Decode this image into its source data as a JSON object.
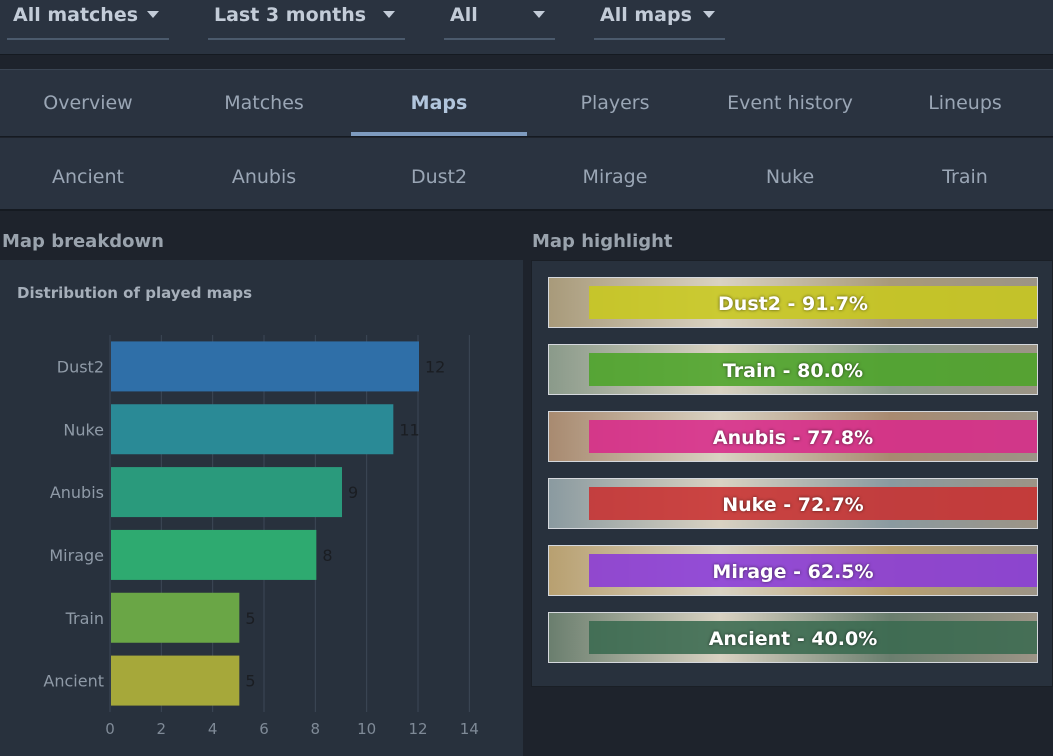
{
  "filters": [
    {
      "label": "All matches"
    },
    {
      "label": "Last 3 months"
    },
    {
      "label": "All"
    },
    {
      "label": "All maps"
    }
  ],
  "tabs": [
    "Overview",
    "Matches",
    "Maps",
    "Players",
    "Event history",
    "Lineups"
  ],
  "active_tab": "Maps",
  "map_tabs": [
    "Ancient",
    "Anubis",
    "Dust2",
    "Mirage",
    "Nuke",
    "Train"
  ],
  "map_breakdown": {
    "title": "Map breakdown",
    "chart_title": "Distribution of played maps"
  },
  "map_highlight": {
    "title": "Map highlight",
    "items": [
      {
        "label": "Dust2 - 91.7%",
        "color": "#c8c81e",
        "bg": "#a89a7a"
      },
      {
        "label": "Train - 80.0%",
        "color": "#4ca428",
        "bg": "#8a9a8a"
      },
      {
        "label": "Anubis - 77.8%",
        "color": "#d82a8a",
        "bg": "#a88a70"
      },
      {
        "label": "Nuke - 72.7%",
        "color": "#c83030",
        "bg": "#8a9aa0"
      },
      {
        "label": "Mirage - 62.5%",
        "color": "#8a3ad8",
        "bg": "#b8a070"
      },
      {
        "label": "Ancient - 40.0%",
        "color": "#3a6a50",
        "bg": "#6a7e6e"
      }
    ]
  },
  "chart_data": {
    "type": "bar",
    "orientation": "horizontal",
    "title": "Distribution of played maps",
    "categories": [
      "Dust2",
      "Nuke",
      "Anubis",
      "Mirage",
      "Train",
      "Ancient"
    ],
    "values": [
      12,
      11,
      9,
      8,
      5,
      5
    ],
    "colors": [
      "#2f6fa8",
      "#2a8a96",
      "#2a9a7c",
      "#2eaa70",
      "#6aa646",
      "#a6a83a"
    ],
    "xlim": [
      0,
      15
    ],
    "xticks": [
      0,
      2,
      4,
      6,
      8,
      10,
      12,
      14
    ],
    "grid": true
  }
}
